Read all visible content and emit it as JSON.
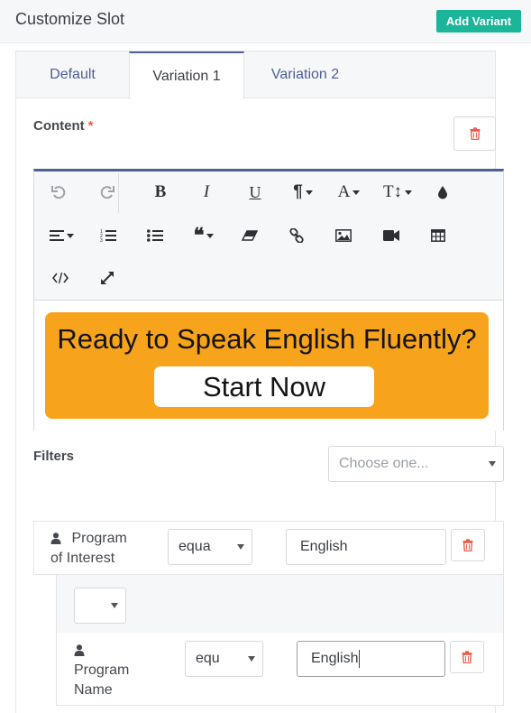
{
  "header": {
    "title": "Customize Slot",
    "add_variant_label": "Add Variant"
  },
  "tabs": [
    {
      "label": "Default",
      "active": false
    },
    {
      "label": "Variation 1",
      "active": true
    },
    {
      "label": "Variation 2",
      "active": false
    }
  ],
  "content": {
    "label": "Content",
    "required_mark": "*",
    "toolbar": [
      {
        "name": "undo-icon",
        "glyph": "⟲"
      },
      {
        "name": "redo-icon",
        "glyph": "⟳"
      },
      {
        "name": "bold-icon",
        "glyph": "B"
      },
      {
        "name": "italic-icon",
        "glyph": "I"
      },
      {
        "name": "underline-icon",
        "glyph": "U"
      },
      {
        "name": "paragraph-icon",
        "glyph": "¶"
      },
      {
        "name": "font-icon",
        "glyph": "A"
      },
      {
        "name": "text-height-icon",
        "glyph": "T↕"
      },
      {
        "name": "color-drop-icon",
        "glyph": "●"
      },
      {
        "name": "align-icon",
        "glyph": "≡"
      },
      {
        "name": "ordered-list-icon",
        "glyph": "1≡"
      },
      {
        "name": "unordered-list-icon",
        "glyph": "•≡"
      },
      {
        "name": "quote-icon",
        "glyph": "❝"
      },
      {
        "name": "eraser-icon",
        "glyph": "⌫"
      },
      {
        "name": "link-icon",
        "glyph": "🔗"
      },
      {
        "name": "image-icon",
        "glyph": "▣"
      },
      {
        "name": "video-icon",
        "glyph": "■"
      },
      {
        "name": "table-icon",
        "glyph": "⊞"
      },
      {
        "name": "code-view-icon",
        "glyph": "</>"
      },
      {
        "name": "fullscreen-icon",
        "glyph": "⤢"
      }
    ],
    "banner": {
      "title": "Ready to Speak English Fluently?",
      "button_label": "Start Now",
      "color": "#f7a31c"
    }
  },
  "filters": {
    "label": "Filters",
    "select_placeholder": "Choose one...",
    "rule1": {
      "field_label": "Program of Interest",
      "field_line1": "Program",
      "field_line2": "of Interest",
      "operator": "equals",
      "operator_visible": "equa",
      "value": "English"
    },
    "group_select_value": "",
    "rule2": {
      "field_line1": "Program",
      "field_line2": "Name",
      "operator": "equals",
      "operator_visible": "equ",
      "value": "English"
    }
  },
  "colors": {
    "accent": "#4f5d99",
    "add_variant_bg": "#1bb59a",
    "danger": "#e8604c"
  }
}
